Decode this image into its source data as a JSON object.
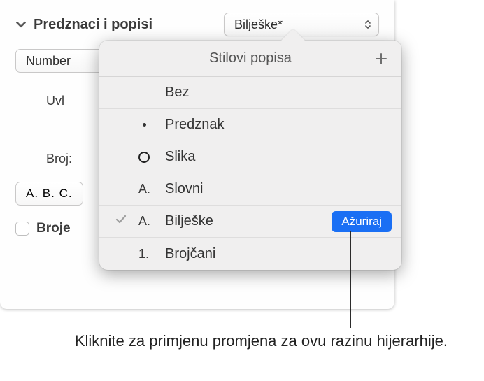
{
  "section": {
    "title": "Predznaci i popisi",
    "style_selected": "Bilješke*"
  },
  "number_btn": "Number",
  "labels": {
    "uvl": "Uvl",
    "broj": "Broj:"
  },
  "abc_display": "A. B. C.",
  "tiered_label": "Broje",
  "popover": {
    "title": "Stilovi popisa",
    "items": [
      {
        "marker_type": "none",
        "label": "Bez",
        "checked": false,
        "update": false
      },
      {
        "marker_type": "bullet",
        "label": "Predznak",
        "checked": false,
        "update": false
      },
      {
        "marker_type": "ring",
        "label": "Slika",
        "checked": false,
        "update": false
      },
      {
        "marker_type": "A",
        "label": "Slovni",
        "checked": false,
        "update": false
      },
      {
        "marker_type": "A",
        "label": "Bilješke",
        "checked": true,
        "update": true
      },
      {
        "marker_type": "1",
        "label": "Brojčani",
        "checked": false,
        "update": false
      }
    ],
    "update_label": "Ažuriraj"
  },
  "callout": "Kliknite za primjenu promjena za ovu razinu hijerarhije."
}
